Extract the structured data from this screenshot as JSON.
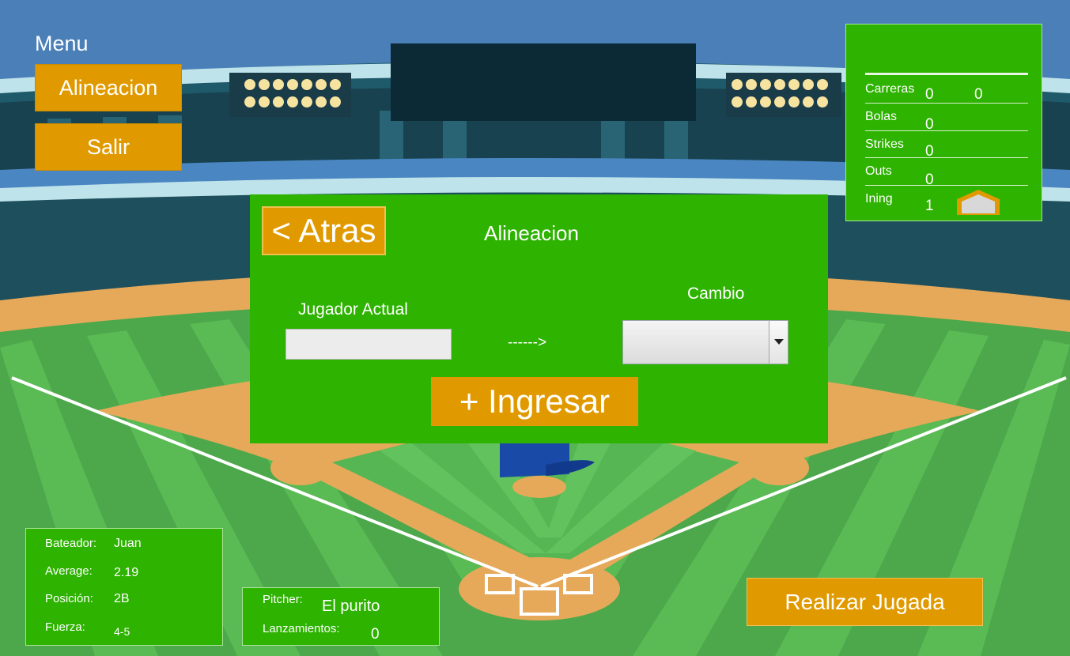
{
  "menu": {
    "title": "Menu",
    "alineacion_label": "Alineacion",
    "salir_label": "Salir"
  },
  "scoreboard": {
    "carreras_label": "Carreras",
    "carreras_value_1": "0",
    "carreras_value_2": "0",
    "bolas_label": "Bolas",
    "bolas_value": "0",
    "strikes_label": "Strikes",
    "strikes_value": "0",
    "outs_label": "Outs",
    "outs_value": "0",
    "ining_label": "Ining",
    "ining_value": "1"
  },
  "dialog": {
    "back_label": "< Atras",
    "title": "Alineacion",
    "current_player_label": "Jugador Actual",
    "current_player_value": "",
    "arrow_text": "------>",
    "change_label": "Cambio",
    "change_selected": "",
    "submit_label": "+ Ingresar"
  },
  "batter": {
    "bateador_label": "Bateador:",
    "bateador_value": "Juan",
    "average_label": "Average:",
    "average_value": "2.19",
    "posicion_label": "Posición:",
    "posicion_value": "2B",
    "fuerza_label": "Fuerza:",
    "fuerza_value": "4-5"
  },
  "pitcher": {
    "pitcher_label": "Pitcher:",
    "pitcher_value": "El purito",
    "lanzamientos_label": "Lanzamientos:",
    "lanzamientos_value": "0"
  },
  "actions": {
    "play_label": "Realizar Jugada"
  },
  "colors": {
    "panel_green": "#2db300",
    "button_orange": "#e09a00",
    "sky": "#4a7fb8",
    "field_green": "#4ca84a",
    "dirt": "#e6a95a"
  }
}
